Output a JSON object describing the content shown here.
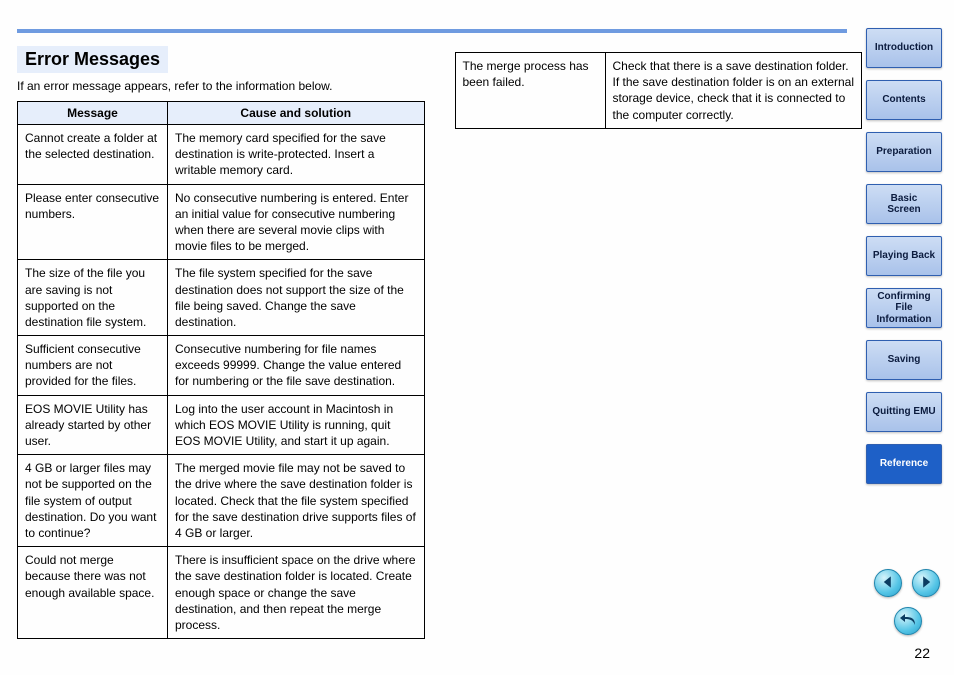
{
  "section_title": "Error Messages",
  "intro": "If an error message appears, refer to the information below.",
  "table": {
    "headers": {
      "message": "Message",
      "cause": "Cause and solution"
    },
    "rows": [
      {
        "message": "Cannot create a folder at the selected destination.",
        "cause": "The memory card specified for the save destination is write-protected. Insert a writable memory card."
      },
      {
        "message": "Please enter consecutive numbers.",
        "cause": "No consecutive numbering is entered. Enter an initial value for consecutive numbering when there are several movie clips with movie files to be merged."
      },
      {
        "message": "The size of the file you are saving is not supported on the destination file system.",
        "cause": "The file system specified for the save destination does not support the size of the file being saved. Change the save destination."
      },
      {
        "message": "Sufficient consecutive numbers are not provided for the files.",
        "cause": "Consecutive numbering for file names exceeds 99999. Change the value entered for numbering or the file save destination."
      },
      {
        "message": "EOS MOVIE Utility has already started by other user.",
        "cause": "Log into the user account in Macintosh in which EOS MOVIE Utility is running, quit EOS MOVIE Utility, and start it up again."
      },
      {
        "message": "4 GB or larger files may not be supported on the file system of output destination. Do you want to continue?",
        "cause": "The merged movie file may not be saved to the drive where the save destination folder is located. Check that the file system specified for the save destination drive supports files of 4 GB or larger."
      },
      {
        "message": "Could not merge because there was not enough available space.",
        "cause": "There is insufficient space on the drive where the save destination folder is located. Create enough space or change the save destination, and then repeat the merge process."
      }
    ]
  },
  "table2": {
    "rows": [
      {
        "message": "The merge process has been failed.",
        "cause": "Check that there is a save destination folder. If the save destination folder is on an external storage device, check that it is connected to the computer correctly."
      }
    ]
  },
  "nav": [
    "Introduction",
    "Contents",
    "Preparation",
    "Basic\nScreen",
    "Playing Back",
    "Confirming File\nInformation",
    "Saving",
    "Quitting EMU",
    "Reference"
  ],
  "nav_active": 8,
  "page_number": "22"
}
